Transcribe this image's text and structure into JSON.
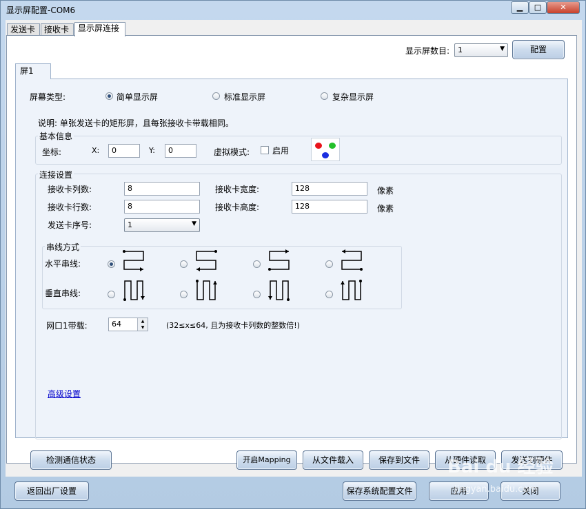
{
  "window": {
    "title": "显示屏配置-COM6"
  },
  "tabs": [
    "发送卡",
    "接收卡",
    "显示屏连接"
  ],
  "header": {
    "screen_count_label": "显示屏数目:",
    "screen_count_value": "1",
    "config_button": "配置"
  },
  "screen_tab": "屏1",
  "screen_type": {
    "label": "屏幕类型:",
    "options": [
      "简单显示屏",
      "标准显示屏",
      "复杂显示屏"
    ],
    "selected": 0
  },
  "description": "说明: 单张发送卡的矩形屏，且每张接收卡带载相同。",
  "basic_info": {
    "title": "基本信息",
    "coord_label": "坐标:",
    "x_label": "X:",
    "x_value": "0",
    "y_label": "Y:",
    "y_value": "0",
    "virtual_label": "虚拟模式:",
    "enable_label": "启用",
    "dot_colors": [
      "#e8141b",
      "#22c02a",
      "#1a2ee0"
    ]
  },
  "connection": {
    "title": "连接设置",
    "cols_label": "接收卡列数:",
    "cols_value": "8",
    "rows_label": "接收卡行数:",
    "rows_value": "8",
    "width_label": "接收卡宽度:",
    "width_value": "128",
    "height_label": "接收卡高度:",
    "height_value": "128",
    "unit": "像素",
    "sender_label": "发送卡序号:",
    "sender_value": "1"
  },
  "wiring": {
    "title": "串线方式",
    "horizontal_label": "水平串线:",
    "vertical_label": "垂直串线:"
  },
  "port": {
    "label": "网口1带载:",
    "value": "64",
    "hint": "(32≤x≤64, 且为接收卡列数的整数倍!)"
  },
  "advanced_link": "高级设置",
  "buttons": {
    "detect": "检测通信状态",
    "mapping": "开启Mapping",
    "load_file": "从文件载入",
    "save_file": "保存到文件",
    "read_hw": "从硬件读取",
    "send_hw": "发送到硬件",
    "factory": "返回出厂设置",
    "save_sys": "保存系统配置文件",
    "apply": "应用",
    "close": "关闭"
  },
  "watermark": {
    "brand": "Bai du 经验",
    "url": "jingyan.baidu.com"
  }
}
